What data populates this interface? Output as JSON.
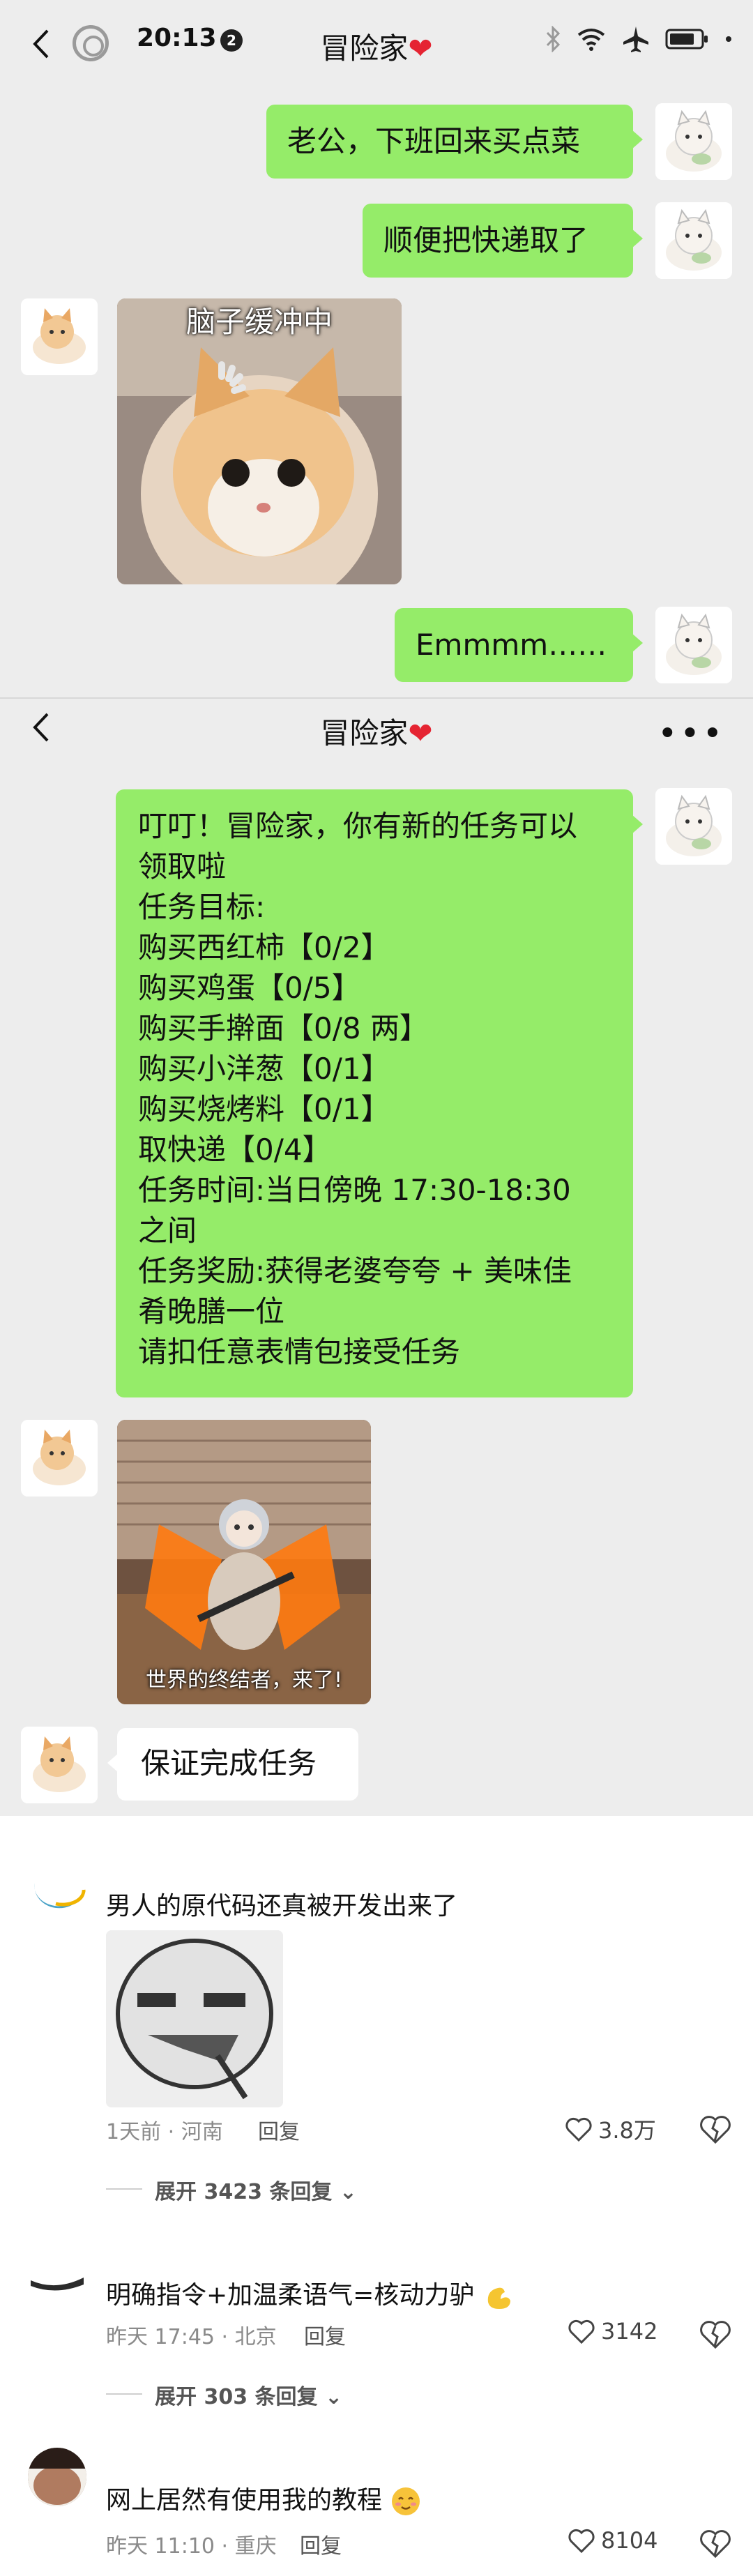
{
  "status": {
    "time": "20:13",
    "notification_count": "2"
  },
  "chat": {
    "title": "冒险家",
    "title_heart": "❤"
  },
  "messages": [
    {
      "side": "right",
      "type": "text",
      "text": "老公，下班回来买点菜"
    },
    {
      "side": "right",
      "type": "text",
      "text": "顺便把快递取了"
    },
    {
      "side": "left",
      "type": "sticker",
      "caption": "脑子缓冲中"
    },
    {
      "side": "right",
      "type": "text",
      "text": "Emmmm……"
    }
  ],
  "chat2": {
    "title": "冒险家",
    "title_heart": "❤",
    "more": "•••"
  },
  "task_message": {
    "lines": [
      "叮叮！冒险家，你有新的任务可以",
      "领取啦",
      "任务目标:",
      "购买西红柿【0/2】",
      "购买鸡蛋【0/5】",
      "购买手擀面【0/8 两】",
      "购买小洋葱【0/1】",
      "购买烧烤料【0/1】",
      "取快递【0/4】",
      "任务时间:当日傍晚 17:30-18:30",
      "之间",
      "任务奖励:获得老婆夸夸 + 美味佳",
      "肴晚膳一位",
      "请扣任意表情包接受任务"
    ]
  },
  "reply_sticker": {
    "caption": "世界的终结者，来了!"
  },
  "reply_text": {
    "text": "保证完成任务"
  },
  "comments": [
    {
      "text": "男人的原代码还真被开发出来了",
      "meta": "1天前 · 河南",
      "reply": "回复",
      "likes": "3.8万",
      "expand": "展开 3423 条回复"
    },
    {
      "text": "明确指令+加温柔语气=核动力驴",
      "meta": "昨天 17:45 · 北京",
      "reply": "回复",
      "likes": "3142",
      "expand": "展开 303 条回复"
    },
    {
      "text": "网上居然有使用我的教程",
      "meta": "昨天 11:10 · 重庆",
      "reply": "回复",
      "likes": "8104"
    }
  ],
  "colors": {
    "green_bubble": "#95ec69",
    "background": "#ededed",
    "heart": "#e52432"
  }
}
